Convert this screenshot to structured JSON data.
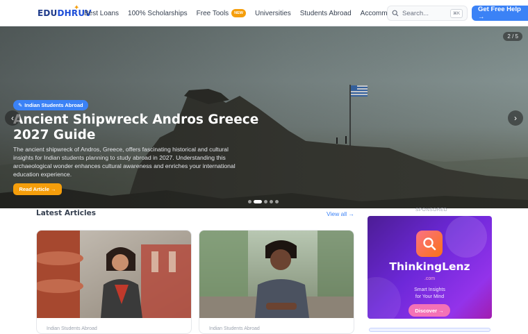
{
  "brand": {
    "part1": "EDU",
    "part2": "DHRUV"
  },
  "nav": {
    "items": [
      {
        "label": "Best Loans"
      },
      {
        "label": "100% Scholarships"
      },
      {
        "label": "Free Tools",
        "badge": "NEW"
      },
      {
        "label": "Universities"
      },
      {
        "label": "Students Abroad"
      },
      {
        "label": "Accommodation"
      }
    ],
    "search_placeholder": "Search...",
    "search_shortcut": "⌘K",
    "cta_label": "Get Free Help →"
  },
  "hero": {
    "slide_counter": "2 / 5",
    "category": "Indian Students Abroad",
    "title": "Ancient Shipwreck Andros Greece 2027 Guide",
    "description": "The ancient shipwreck of Andros, Greece, offers fascinating historical and cultural insights for Indian students planning to study abroad in 2027. Understanding this archaeological wonder enhances cultural awareness and enriches your international education experience.",
    "button_label": "Read Article →",
    "prev_glyph": "‹",
    "next_glyph": "›",
    "slide_total": 5,
    "slide_active": 2
  },
  "latest": {
    "title": "Latest Articles",
    "view_all": "View all →",
    "cards": [
      {
        "meta": "Indian Students Abroad"
      },
      {
        "meta": "Indian Students Abroad"
      }
    ]
  },
  "ad": {
    "sponsored_label": "SPONSORED",
    "name": "ThinkingLenz",
    "domain": ".com",
    "tagline_1": "Smart Insights",
    "tagline_2": "for Your Mind",
    "button_label": "Discover →"
  },
  "colors": {
    "accent": "#3b82f6",
    "orange": "#f59e0b",
    "ad_purple": "#6d28d9",
    "ad_pink": "#f472b6"
  }
}
